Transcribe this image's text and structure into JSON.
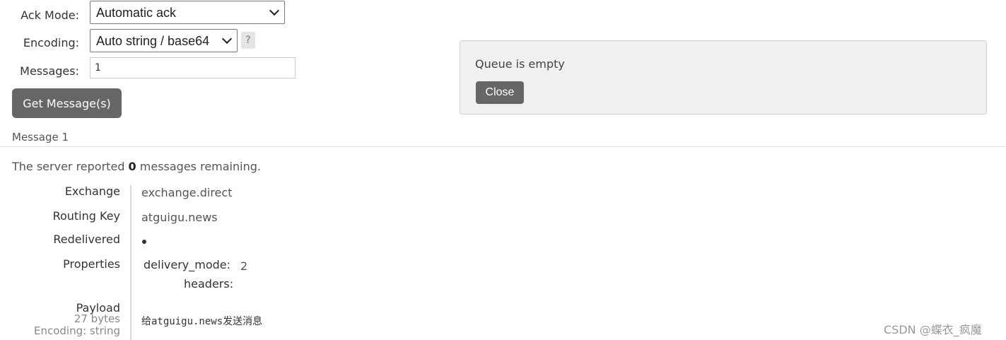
{
  "form": {
    "ack_mode_label": "Ack Mode:",
    "ack_mode_value": "Automatic ack",
    "encoding_label": "Encoding:",
    "encoding_value": "Auto string / base64",
    "help_label": "?",
    "messages_label": "Messages:",
    "messages_value": "1",
    "get_button": "Get Message(s)"
  },
  "notice": {
    "text": "Queue is empty",
    "close_button": "Close"
  },
  "message": {
    "title": "Message 1",
    "remaining_prefix": "The server reported ",
    "remaining_count": "0",
    "remaining_suffix": " messages remaining.",
    "fields": {
      "exchange_key": "Exchange",
      "exchange_value": "exchange.direct",
      "routing_key_key": "Routing Key",
      "routing_key_value": "atguigu.news",
      "redelivered_key": "Redelivered",
      "properties_key": "Properties",
      "prop_delivery_mode_key": "delivery_mode:",
      "prop_delivery_mode_value": "2",
      "prop_headers_key": "headers:",
      "payload_key": "Payload",
      "payload_bytes": "27 bytes",
      "payload_encoding": "Encoding: string",
      "payload_value": "给atguigu.news发送消息"
    }
  },
  "watermark": "CSDN @蝶衣_疯魔"
}
